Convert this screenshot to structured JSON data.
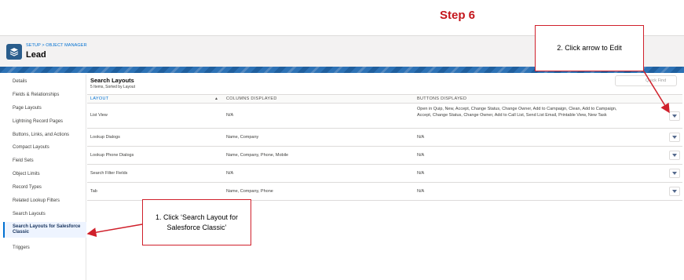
{
  "step_title": "Step 6",
  "header": {
    "breadcrumb": "SETUP > OBJECT MANAGER",
    "object_name": "Lead",
    "icon": "layers-icon"
  },
  "sidebar": {
    "items": [
      {
        "label": "Details"
      },
      {
        "label": "Fields & Relationships"
      },
      {
        "label": "Page Layouts"
      },
      {
        "label": "Lightning Record Pages"
      },
      {
        "label": "Buttons, Links, and Actions"
      },
      {
        "label": "Compact Layouts"
      },
      {
        "label": "Field Sets"
      },
      {
        "label": "Object Limits"
      },
      {
        "label": "Record Types"
      },
      {
        "label": "Related Lookup Filters"
      },
      {
        "label": "Search Layouts"
      },
      {
        "label": "Search Layouts for Salesforce Classic"
      },
      {
        "label": "Triggers"
      }
    ]
  },
  "panel": {
    "title": "Search Layouts",
    "subtitle": "5 Items, Sorted by Layout",
    "quick_find_placeholder": "Quick Find",
    "columns": {
      "layout": "LAYOUT",
      "columns_displayed": "COLUMNS DISPLAYED",
      "buttons_displayed": "BUTTONS DISPLAYED"
    },
    "rows": [
      {
        "layout": "List View",
        "columns": "N/A",
        "buttons": "Open in Quip, New, Accept, Change Status, Change Owner, Add to Campaign, Clean, Add to Campaign, Accept, Change Status, Change Owner, Add to Call List, Send List Email, Printable View, New Task"
      },
      {
        "layout": "Lookup Dialogs",
        "columns": "Name, Company",
        "buttons": "N/A"
      },
      {
        "layout": "Lookup Phone Dialogs",
        "columns": "Name, Company, Phone, Mobile",
        "buttons": "N/A"
      },
      {
        "layout": "Search Filter Fields",
        "columns": "N/A",
        "buttons": "N/A"
      },
      {
        "layout": "Tab",
        "columns": "Name, Company, Phone",
        "buttons": "N/A"
      }
    ]
  },
  "callouts": {
    "one": "1. Click ‘Search Layout for Salesforce Classic’",
    "two": "2. Click arrow to Edit"
  },
  "colors": {
    "accent_red": "#c4161c",
    "link_blue": "#0070d2",
    "header_band": "#1f5f9e"
  }
}
